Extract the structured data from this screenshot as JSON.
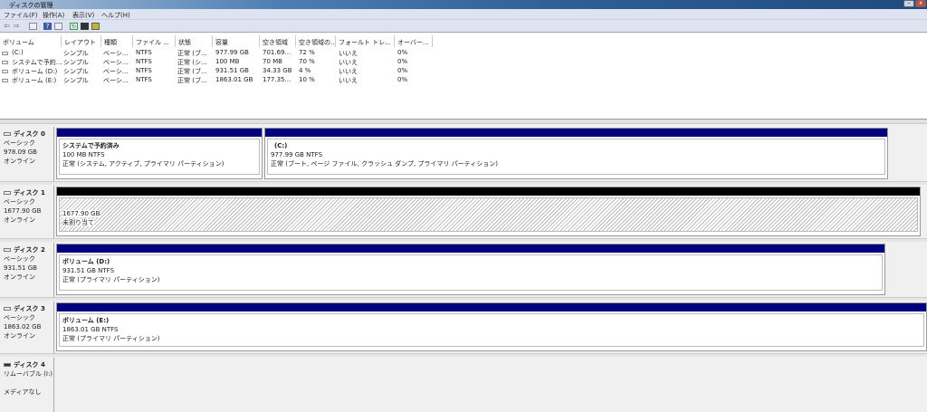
{
  "window": {
    "title": "ディスクの管理"
  },
  "menu": [
    "ファイル(F)",
    "操作(A)",
    "表示(V)",
    "ヘルプ(H)"
  ],
  "toolbar": [
    "back-icon",
    "forward-icon",
    "console-tree-icon",
    "help-icon",
    "show-pane-icon",
    "refresh-icon",
    "properties-icon",
    "rescan-icon"
  ],
  "columns": [
    "ボリューム",
    "レイアウト",
    "種類",
    "ファイル ...",
    "状態",
    "容量",
    "空き領域",
    "空き領域の...",
    "フォールト トレ...",
    "オーバー..."
  ],
  "rows": [
    [
      "(C:)",
      "シンプル",
      "ベーシ...",
      "NTFS",
      "正常 (ブ...",
      "977.99 GB",
      "701.69...",
      "72 %",
      "いいえ",
      "0%"
    ],
    [
      "システムで予約...",
      "シンプル",
      "ベーシ...",
      "NTFS",
      "正常 (シ...",
      "100 MB",
      "70 MB",
      "70 %",
      "いいえ",
      "0%"
    ],
    [
      "ボリューム (D:)",
      "シンプル",
      "ベーシ...",
      "NTFS",
      "正常 (ブ...",
      "931.51 GB",
      "34.33 GB",
      "4 %",
      "いいえ",
      "0%"
    ],
    [
      "ボリューム (E:)",
      "シンプル",
      "ベーシ...",
      "NTFS",
      "正常 (ブ...",
      "1863.01 GB",
      "177.35...",
      "10 %",
      "いいえ",
      "0%"
    ]
  ],
  "disks": [
    {
      "name": "ディスク 0",
      "type": "ベーシック",
      "size": "978.09 GB",
      "status": "オンライン",
      "partitions": [
        {
          "name": "システムで予約済み",
          "size": "100 MB NTFS",
          "status": "正常 (システム, アクティブ, プライマリ パーティション)"
        },
        {
          "name": "(C:)",
          "size": "977.99 GB NTFS",
          "status": "正常 (ブート, ページ ファイル, クラッシュ ダンプ, プライマリ パーティション)"
        }
      ]
    },
    {
      "name": "ディスク 1",
      "type": "ベーシック",
      "size": "1677.90 GB",
      "status": "オンライン",
      "partitions": [
        {
          "size": "1677.90 GB",
          "status": "未割り当て"
        }
      ]
    },
    {
      "name": "ディスク 2",
      "type": "ベーシック",
      "size": "931.51 GB",
      "status": "オンライン",
      "partitions": [
        {
          "name": "ボリューム (D:)",
          "size": "931.51 GB NTFS",
          "status": "正常 (プライマリ パーティション)"
        }
      ]
    },
    {
      "name": "ディスク 3",
      "type": "ベーシック",
      "size": "1863.02 GB",
      "status": "オンライン",
      "partitions": [
        {
          "name": "ボリューム (E:)",
          "size": "1863.01 GB NTFS",
          "status": "正常 (プライマリ パーティション)"
        }
      ]
    },
    {
      "name": "ディスク 4",
      "type": "リムーバブル (I:)",
      "status": "メディアなし"
    }
  ]
}
